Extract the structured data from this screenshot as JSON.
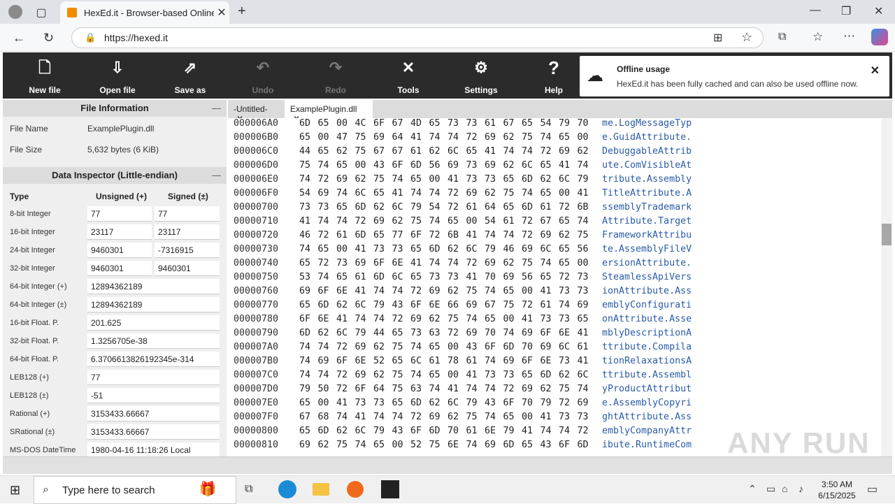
{
  "browser": {
    "tab_title": "HexEd.it - Browser-based Online a",
    "url": "https://hexed.it"
  },
  "toolbar": [
    {
      "label": "New file",
      "icon": "new-file-icon",
      "enabled": true
    },
    {
      "label": "Open file",
      "icon": "open-file-icon",
      "enabled": true
    },
    {
      "label": "Save as",
      "icon": "save-as-icon",
      "enabled": true
    },
    {
      "label": "Undo",
      "icon": "undo-icon",
      "enabled": false
    },
    {
      "label": "Redo",
      "icon": "redo-icon",
      "enabled": false
    },
    {
      "label": "Tools",
      "icon": "tools-icon",
      "enabled": true
    },
    {
      "label": "Settings",
      "icon": "gear-icon",
      "enabled": true
    },
    {
      "label": "Help",
      "icon": "help-icon",
      "enabled": true
    }
  ],
  "notification": {
    "title": "Offline usage",
    "body": "HexEd.it has been fully cached and can also be used offline now."
  },
  "file_info": {
    "heading": "File Information",
    "name_label": "File Name",
    "name_value": "ExamplePlugin.dll",
    "size_label": "File Size",
    "size_value": "5,632 bytes (6 KiB)"
  },
  "inspector": {
    "heading": "Data Inspector (Little-endian)",
    "col_type": "Type",
    "col_unsigned": "Unsigned (+)",
    "col_signed": "Signed (±)",
    "rows": [
      {
        "type": "8-bit Integer",
        "u": "77",
        "s": "77"
      },
      {
        "type": "16-bit Integer",
        "u": "23117",
        "s": "23117"
      },
      {
        "type": "24-bit Integer",
        "u": "9460301",
        "s": "-7316915"
      },
      {
        "type": "32-bit Integer",
        "u": "9460301",
        "s": "9460301"
      },
      {
        "type": "64-bit Integer (+)",
        "v": "12894362189"
      },
      {
        "type": "64-bit Integer (±)",
        "v": "12894362189"
      },
      {
        "type": "16-bit Float. P.",
        "v": "201.625"
      },
      {
        "type": "32-bit Float. P.",
        "v": "1.3256705e-38"
      },
      {
        "type": "64-bit Float. P.",
        "v": "6.3706613826192345e-314"
      },
      {
        "type": "LEB128 (+)",
        "v": "77"
      },
      {
        "type": "LEB128 (±)",
        "v": "-51"
      },
      {
        "type": "Rational (+)",
        "v": "3153433.66667"
      },
      {
        "type": "SRational (±)",
        "v": "3153433.66667"
      },
      {
        "type": "MS-DOS DateTime",
        "v": "1980-04-16 11:18:26 Local"
      }
    ]
  },
  "file_tabs": [
    {
      "label": "-Untitled-",
      "active": false
    },
    {
      "label": "ExamplePlugin.dll",
      "active": true
    }
  ],
  "hex_rows": [
    {
      "offset": "000006A0",
      "bytes": "6D 65 00 4C 6F 67 4D 65 73 73 61 67 65 54 79 70",
      "ascii": "me.LogMessageTyp"
    },
    {
      "offset": "000006B0",
      "bytes": "65 00 47 75 69 64 41 74 74 72 69 62 75 74 65 00",
      "ascii": "e.GuidAttribute."
    },
    {
      "offset": "000006C0",
      "bytes": "44 65 62 75 67 67 61 62 6C 65 41 74 74 72 69 62",
      "ascii": "DebuggableAttrib"
    },
    {
      "offset": "000006D0",
      "bytes": "75 74 65 00 43 6F 6D 56 69 73 69 62 6C 65 41 74",
      "ascii": "ute.ComVisibleAt"
    },
    {
      "offset": "000006E0",
      "bytes": "74 72 69 62 75 74 65 00 41 73 73 65 6D 62 6C 79",
      "ascii": "tribute.Assembly"
    },
    {
      "offset": "000006F0",
      "bytes": "54 69 74 6C 65 41 74 74 72 69 62 75 74 65 00 41",
      "ascii": "TitleAttribute.A"
    },
    {
      "offset": "00000700",
      "bytes": "73 73 65 6D 62 6C 79 54 72 61 64 65 6D 61 72 6B",
      "ascii": "ssemblyTrademark"
    },
    {
      "offset": "00000710",
      "bytes": "41 74 74 72 69 62 75 74 65 00 54 61 72 67 65 74",
      "ascii": "Attribute.Target"
    },
    {
      "offset": "00000720",
      "bytes": "46 72 61 6D 65 77 6F 72 6B 41 74 74 72 69 62 75",
      "ascii": "FrameworkAttribu"
    },
    {
      "offset": "00000730",
      "bytes": "74 65 00 41 73 73 65 6D 62 6C 79 46 69 6C 65 56",
      "ascii": "te.AssemblyFileV"
    },
    {
      "offset": "00000740",
      "bytes": "65 72 73 69 6F 6E 41 74 74 72 69 62 75 74 65 00",
      "ascii": "ersionAttribute."
    },
    {
      "offset": "00000750",
      "bytes": "53 74 65 61 6D 6C 65 73 73 41 70 69 56 65 72 73",
      "ascii": "SteamlessApiVers"
    },
    {
      "offset": "00000760",
      "bytes": "69 6F 6E 41 74 74 72 69 62 75 74 65 00 41 73 73",
      "ascii": "ionAttribute.Ass"
    },
    {
      "offset": "00000770",
      "bytes": "65 6D 62 6C 79 43 6F 6E 66 69 67 75 72 61 74 69",
      "ascii": "emblyConfigurati"
    },
    {
      "offset": "00000780",
      "bytes": "6F 6E 41 74 74 72 69 62 75 74 65 00 41 73 73 65",
      "ascii": "onAttribute.Asse"
    },
    {
      "offset": "00000790",
      "bytes": "6D 62 6C 79 44 65 73 63 72 69 70 74 69 6F 6E 41",
      "ascii": "mblyDescriptionA"
    },
    {
      "offset": "000007A0",
      "bytes": "74 74 72 69 62 75 74 65 00 43 6F 6D 70 69 6C 61",
      "ascii": "ttribute.Compila"
    },
    {
      "offset": "000007B0",
      "bytes": "74 69 6F 6E 52 65 6C 61 78 61 74 69 6F 6E 73 41",
      "ascii": "tionRelaxationsA"
    },
    {
      "offset": "000007C0",
      "bytes": "74 74 72 69 62 75 74 65 00 41 73 73 65 6D 62 6C",
      "ascii": "ttribute.Assembl"
    },
    {
      "offset": "000007D0",
      "bytes": "79 50 72 6F 64 75 63 74 41 74 74 72 69 62 75 74",
      "ascii": "yProductAttribut"
    },
    {
      "offset": "000007E0",
      "bytes": "65 00 41 73 73 65 6D 62 6C 79 43 6F 70 79 72 69",
      "ascii": "e.AssemblyCopyri"
    },
    {
      "offset": "000007F0",
      "bytes": "67 68 74 41 74 74 72 69 62 75 74 65 00 41 73 73",
      "ascii": "ghtAttribute.Ass"
    },
    {
      "offset": "00000800",
      "bytes": "65 6D 62 6C 79 43 6F 6D 70 61 6E 79 41 74 74 72",
      "ascii": "emblyCompanyAttr"
    },
    {
      "offset": "00000810",
      "bytes": "69 62 75 74 65 00 52 75 6E 74 69 6D 65 43 6F 6D",
      "ascii": "ibute.RuntimeCom"
    }
  ],
  "taskbar": {
    "search_placeholder": "Type here to search",
    "time": "3:50 AM",
    "date": "6/15/2025"
  },
  "watermark": "ANY RUN"
}
